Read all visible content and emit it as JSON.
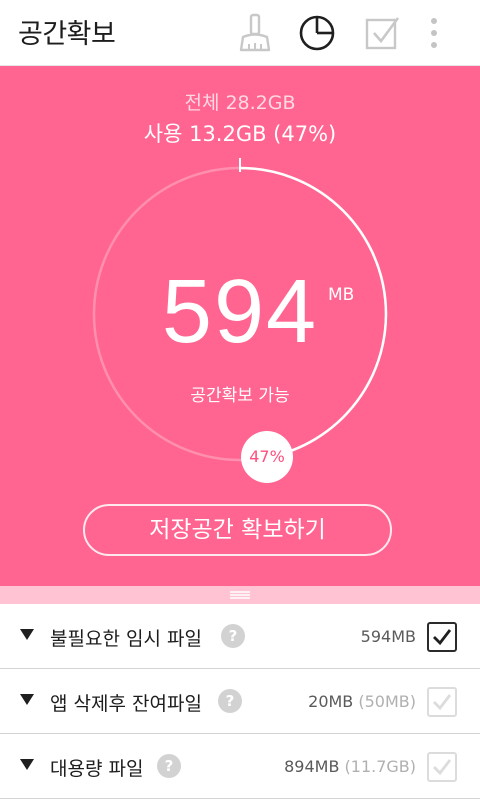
{
  "app": {
    "title": "공간확보"
  },
  "toolbar": {
    "icons": [
      "cleaner-brush-icon",
      "pie-chart-icon",
      "checkbox-icon",
      "overflow-menu-icon"
    ]
  },
  "storage": {
    "total_text": "전체 28.2GB",
    "used_text": "사용 13.2GB (47%)",
    "used_percent": 47,
    "reclaimable_value": "594",
    "reclaimable_unit": "MB",
    "caption": "공간확보 가능",
    "percent_badge": "47%",
    "action_label": "저장공간 확보하기"
  },
  "categories": [
    {
      "label": "불필요한 임시 파일",
      "size": "594MB",
      "sub_size": "",
      "checked": true
    },
    {
      "label": "앱 삭제후 잔여파일",
      "size": "20MB",
      "sub_size": "(50MB)",
      "checked": false
    },
    {
      "label": "대용량 파일",
      "size": "894MB",
      "sub_size": "(11.7GB)",
      "checked": false
    }
  ],
  "colors": {
    "accent": "#ff6590",
    "handle": "#ffc3d3",
    "badge_text": "#ff4f7e"
  }
}
